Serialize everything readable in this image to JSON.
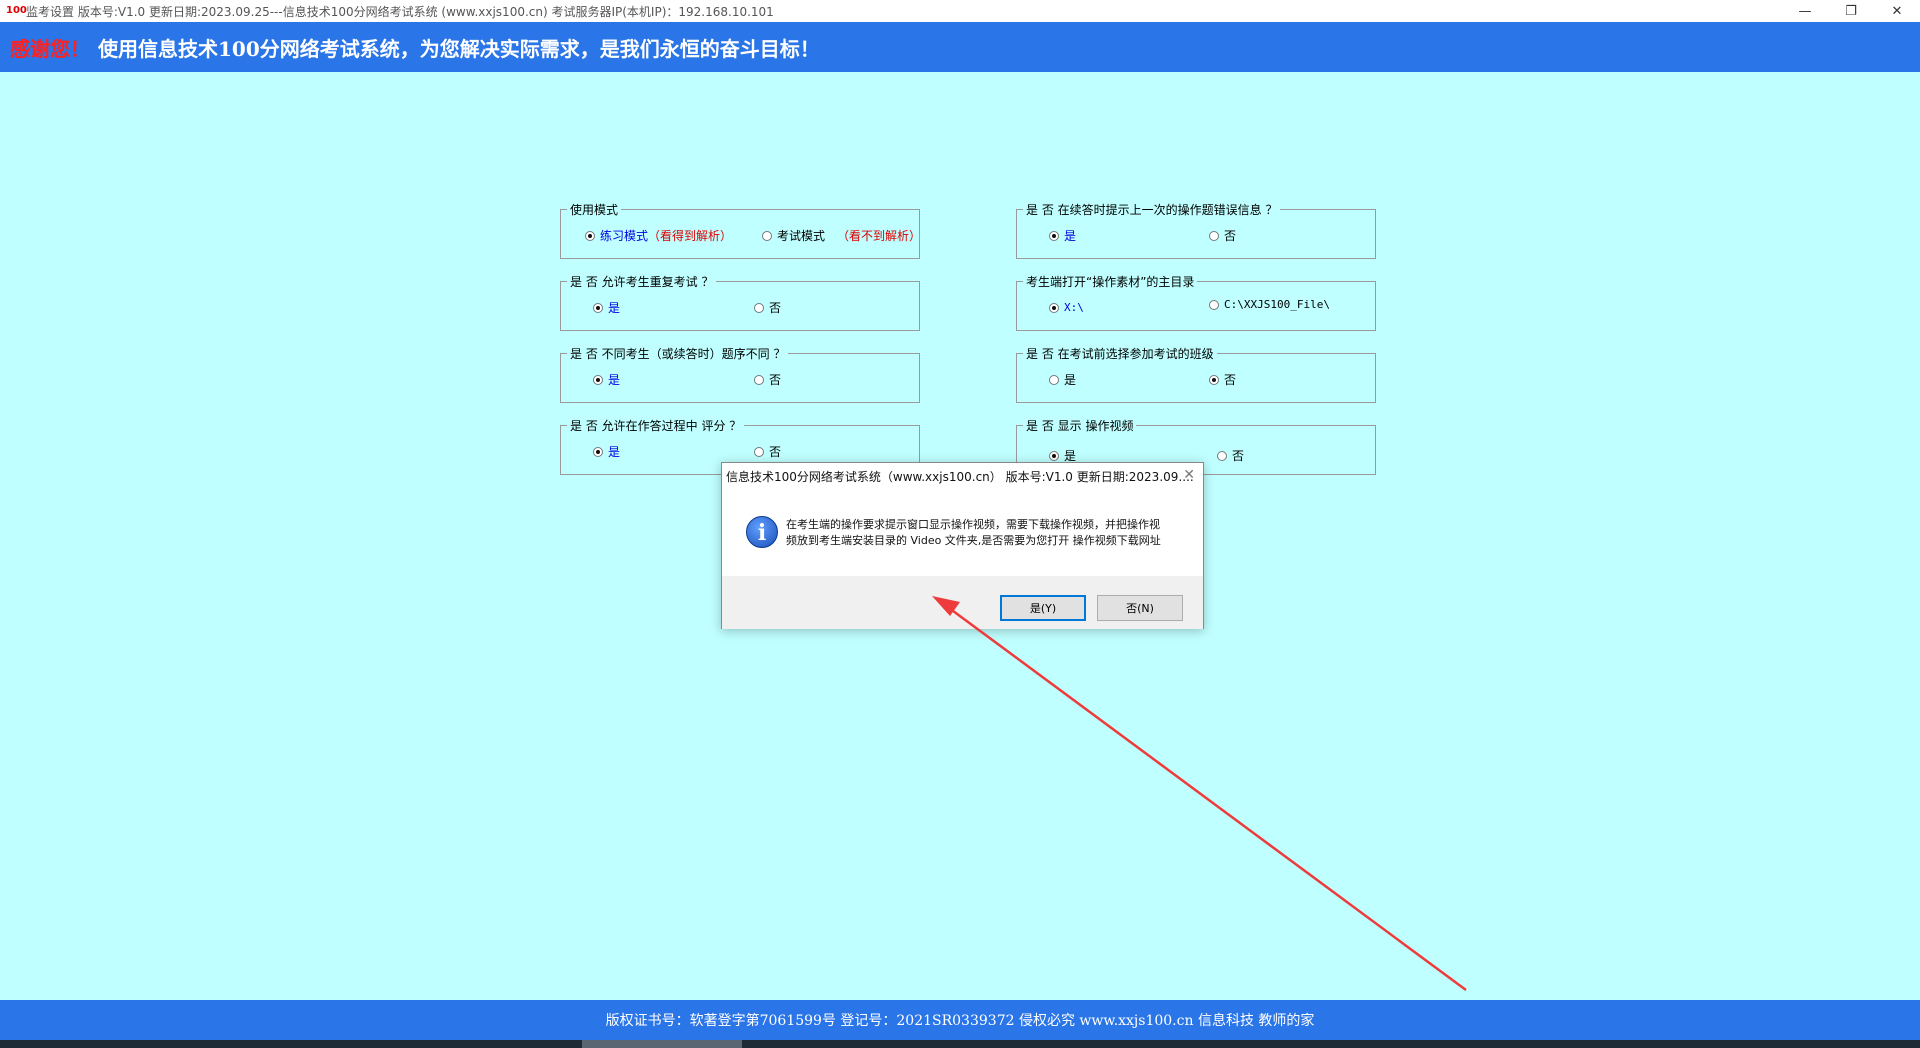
{
  "window": {
    "app_icon": "100",
    "title": "监考设置 版本号:V1.0 更新日期:2023.09.25---信息技术100分网络考试系统    (www.xxjs100.cn)     考试服务器IP(本机IP)：192.168.10.101",
    "minimize": "—",
    "restore": "❐",
    "close": "✕"
  },
  "banner": {
    "thanks": "感谢您！",
    "slogan": "使用信息技术100分网络考试系统，为您解决实际需求，是我们永恒的奋斗目标！"
  },
  "groups": {
    "mode": {
      "legend": "使用模式",
      "opt1": "练习模式",
      "opt1_note": "（看得到解析）",
      "opt2": "考试模式",
      "opt2_note": "（看不到解析）"
    },
    "retake": {
      "legend": "是 否  允许考生重复考试 ？",
      "yes": "是",
      "no": "否"
    },
    "order": {
      "legend": "是 否  不同考生（或续答时）题序不同 ？",
      "yes": "是",
      "no": "否"
    },
    "score": {
      "legend": "是 否  允许在作答过程中 评分 ？",
      "yes": "是",
      "no": "否"
    },
    "prev_err": {
      "legend": "是 否  在续答时提示上一次的操作题错误信息 ？",
      "yes": "是",
      "no": "否"
    },
    "material": {
      "legend": "考生端打开“操作素材”的主目录",
      "opt1": "X:\\",
      "opt2": "C:\\XXJS100_File\\"
    },
    "class": {
      "legend": "是 否 在考试前选择参加考试的班级",
      "yes": "是",
      "no": "否"
    },
    "video": {
      "legend": "是 否 显示 操作视频",
      "yes": "是",
      "no": "否"
    }
  },
  "dialog": {
    "title": "信息技术100分网络考试系统（www.xxjs100.cn） 版本号:V1.0 更新日期:2023.09....",
    "close": "✕",
    "icon": "i",
    "message_line1": "在考生端的操作要求提示窗口显示操作视频，需要下载操作视频，并把操作视",
    "message_line2": "频放到考生端安装目录的 Video 文件夹,是否需要为您打开 操作视频下载网址",
    "yes_button": "是(Y)",
    "no_button": "否(N)"
  },
  "footer": {
    "text": "版权证书号：软著登字第7061599号 登记号：2021SR0339372  侵权必究  www.xxjs100.cn  信息科技 教师的家"
  },
  "colors": {
    "background": "#bfffff",
    "banner": "#2a75e8",
    "thanks": "#ff2020",
    "arrow": "#ee3b3b"
  }
}
